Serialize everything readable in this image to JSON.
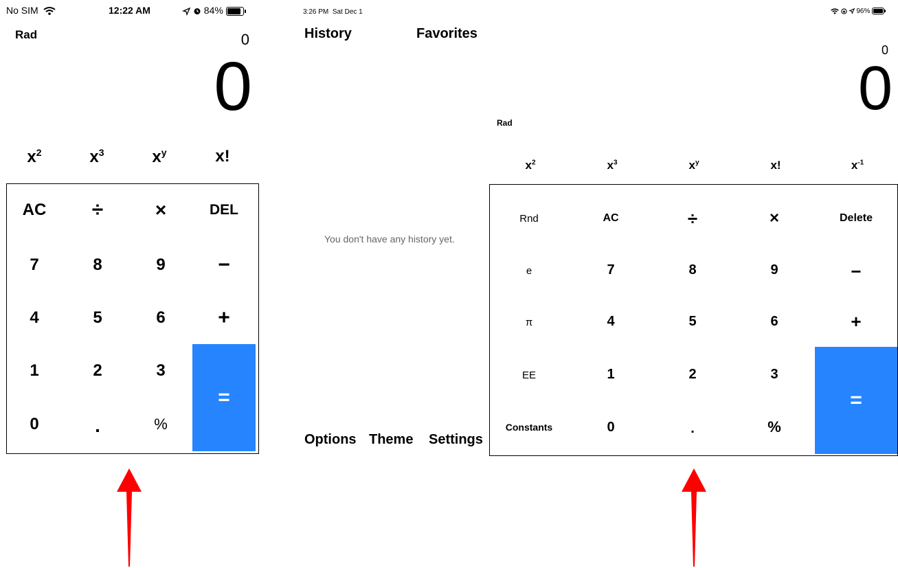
{
  "left_phone": {
    "status": {
      "carrier": "No SIM",
      "time": "12:22 AM",
      "battery": "84%",
      "battery_level": 0.84
    },
    "mode": "Rad",
    "previous": "0",
    "display": "0",
    "sci_row": [
      {
        "base": "x",
        "sup": "2"
      },
      {
        "base": "x",
        "sup": "3"
      },
      {
        "base": "x",
        "sup": "y"
      },
      {
        "base": "x!",
        "sup": ""
      }
    ],
    "keys": {
      "ac": "AC",
      "divide": "÷",
      "multiply": "×",
      "del": "DEL",
      "seven": "7",
      "eight": "8",
      "nine": "9",
      "minus": "−",
      "four": "4",
      "five": "5",
      "six": "6",
      "plus": "+",
      "one": "1",
      "two": "2",
      "three": "3",
      "zero": "0",
      "dot": ".",
      "percent": "%",
      "equals": "="
    }
  },
  "right_tablet": {
    "status": {
      "time": "3:26 PM",
      "date": "Sat Dec 1",
      "battery": "96%",
      "battery_level": 0.96
    },
    "tabs": {
      "history": "History",
      "favorites": "Favorites"
    },
    "empty_history": "You don't have any history yet.",
    "bottom_tabs": {
      "options": "Options",
      "theme": "Theme",
      "settings": "Settings"
    },
    "previous": "0",
    "display": "0",
    "mode": "Rad",
    "sci_row": [
      {
        "base": "x",
        "sup": "2"
      },
      {
        "base": "x",
        "sup": "3"
      },
      {
        "base": "x",
        "sup": "y"
      },
      {
        "base": "x!",
        "sup": ""
      },
      {
        "base": "x",
        "sup": "-1"
      }
    ],
    "keys": {
      "rnd": "Rnd",
      "ac": "AC",
      "divide": "÷",
      "multiply": "×",
      "delete": "Delete",
      "e": "e",
      "seven": "7",
      "eight": "8",
      "nine": "9",
      "minus": "−",
      "pi": "π",
      "four": "4",
      "five": "5",
      "six": "6",
      "plus": "+",
      "ee": "EE",
      "one": "1",
      "two": "2",
      "three": "3",
      "constants": "Constants",
      "zero": "0",
      "dot": ".",
      "percent": "%",
      "equals": "="
    }
  },
  "annotation_color": "#ff0000",
  "accent_color": "#2684ff"
}
